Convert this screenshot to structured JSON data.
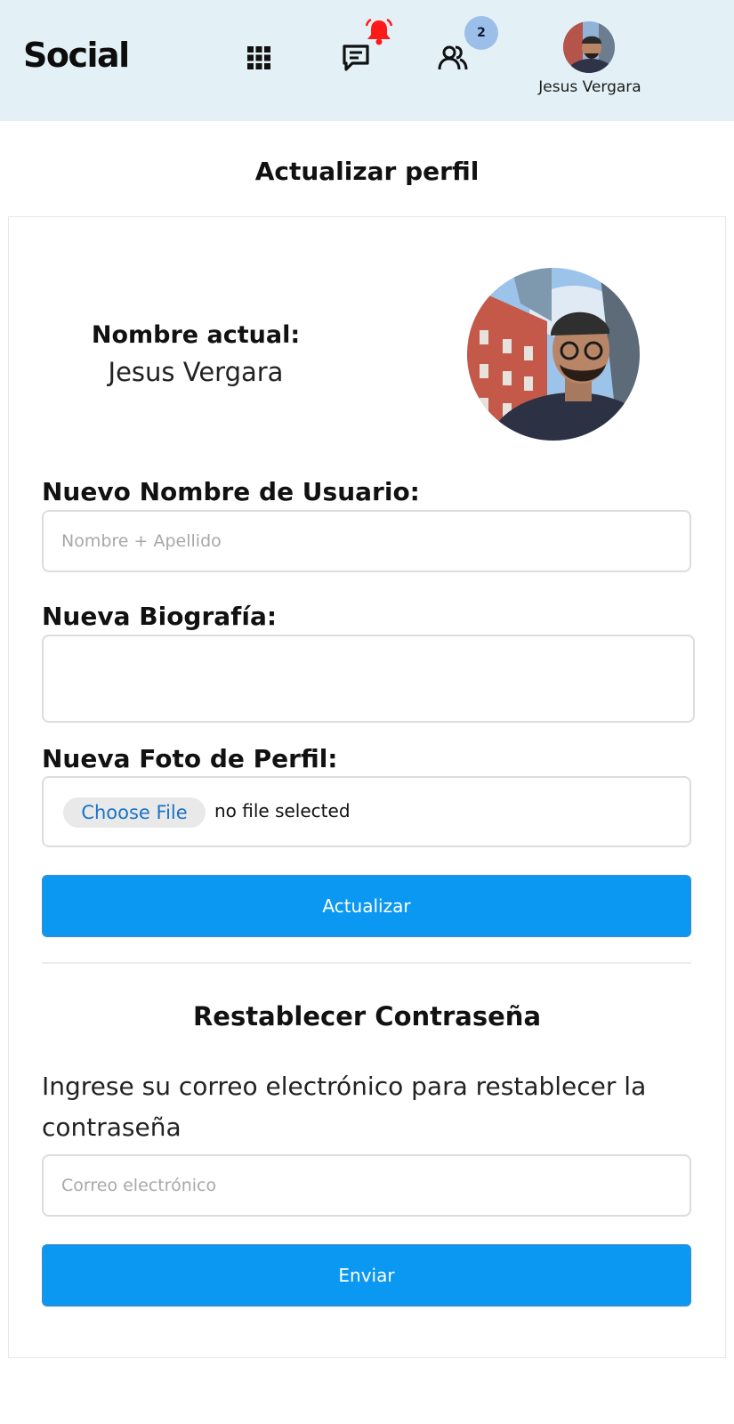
{
  "header": {
    "logo": "Social",
    "friends_badge_count": "2",
    "user_name": "Jesus Vergara",
    "icons": {
      "apps": "grid-icon",
      "messages": "message-icon",
      "notifications": "bell-icon",
      "friends": "users-icon"
    },
    "colors": {
      "background": "#e3f1f7",
      "bell": "#ff1a1a",
      "badge": "#9cbfea"
    }
  },
  "page": {
    "title": "Actualizar perfil"
  },
  "profile": {
    "current_name_label": "Nombre actual:",
    "current_name_value": "Jesus Vergara"
  },
  "form": {
    "name_label": "Nuevo Nombre de Usuario:",
    "name_placeholder": "Nombre + Apellido",
    "name_value": "",
    "bio_label": "Nueva Biografía:",
    "bio_value": "",
    "photo_label": "Nueva Foto de Perfil:",
    "choose_file_label": "Choose File",
    "file_status": "no file selected",
    "submit_label": "Actualizar"
  },
  "reset": {
    "title": "Restablecer Contraseña",
    "description": "Ingrese su correo electrónico para restablecer la contraseña",
    "email_placeholder": "Correo electrónico",
    "email_value": "",
    "submit_label": "Enviar"
  },
  "colors": {
    "primary_button": "#0a98f2",
    "button_text": "#ffffff",
    "input_border": "#dcdcdc"
  }
}
